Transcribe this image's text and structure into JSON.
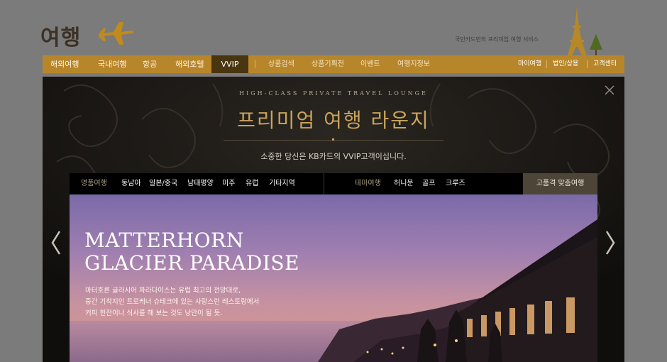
{
  "brand": {
    "logo_text": "여행",
    "tagline": "국민카드만의 프리미엄 여행 서비스"
  },
  "nav": {
    "main": [
      "해외여행",
      "국내여행",
      "항공",
      "해외호텔",
      "VVIP"
    ],
    "sub": [
      "상품검색",
      "상품기획전",
      "이벤트",
      "여행지정보"
    ],
    "utility": [
      "마이여행",
      "법인/상용",
      "고객센터"
    ]
  },
  "lounge": {
    "subtitle": "HIGH-CLASS PRIVATE TRAVEL LOUNGE",
    "title": "프리미엄 여행 라운지",
    "description": "소중한 당신은 KB카드의 VVIP고객이십니다."
  },
  "tabs": {
    "group1_label": "명품여행",
    "group1": [
      "동남아",
      "일본/중국",
      "남태평양",
      "미주",
      "유럽",
      "기타지역"
    ],
    "group2_label": "테마여행",
    "group2": [
      "허니문",
      "골프",
      "크루즈"
    ],
    "custom_button": "고품격 맞춤여행"
  },
  "hero": {
    "title_line1": "MATTERHORN",
    "title_line2": "GLACIER PARADISE",
    "desc_line1": "마터호른 글라시어 파라다이스는 유럽 최고의 전망대로,",
    "desc_line2": "중간 기착지인 트로케너 슈테크에 있는 사랑스런 레스토랑에서",
    "desc_line3": "커피 한잔이나 식사를 해 보는 것도 낭만이 될 듯."
  },
  "colors": {
    "nav_gold": "#b8862a",
    "vvip_active": "#4a3511",
    "title_gold": "#c9a45a",
    "panel_bg": "#141210"
  },
  "icons": [
    "airplane-icon",
    "eiffel-tower-icon",
    "tree-icon",
    "close-icon",
    "chevron-left-icon",
    "chevron-right-icon"
  ]
}
